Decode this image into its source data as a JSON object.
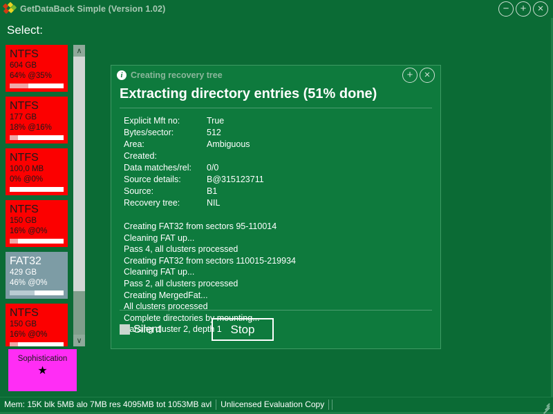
{
  "window": {
    "title": "GetDataBack Simple (Version 1.02)",
    "icon": "app-diamonds-icon",
    "controls": [
      {
        "name": "minimize",
        "glyph": "−"
      },
      {
        "name": "maximize",
        "glyph": "+"
      },
      {
        "name": "close",
        "glyph": "×"
      }
    ]
  },
  "select_label": "Select:",
  "drives": [
    {
      "fs": "NTFS",
      "size": "604 GB",
      "pct": "64% @35%",
      "bar_pct": 35,
      "type": "ntfs"
    },
    {
      "fs": "NTFS",
      "size": "177 GB",
      "pct": "18% @16%",
      "bar_pct": 16,
      "type": "ntfs"
    },
    {
      "fs": "NTFS",
      "size": "100,0 MB",
      "pct": "0% @0%",
      "bar_pct": 0,
      "type": "ntfs"
    },
    {
      "fs": "NTFS",
      "size": "150 GB",
      "pct": "16% @0%",
      "bar_pct": 16,
      "type": "ntfs"
    },
    {
      "fs": "FAT32",
      "size": "429 GB",
      "pct": "46% @0%",
      "bar_pct": 46,
      "type": "fat32"
    },
    {
      "fs": "NTFS",
      "size": "150 GB",
      "pct": "16% @0%",
      "bar_pct": 16,
      "type": "ntfs"
    }
  ],
  "scrollbar": {
    "up_glyph": "∧",
    "down_glyph": "∨"
  },
  "sophistication": {
    "label": "Sophistication",
    "star": "★"
  },
  "dialog": {
    "title": "Creating recovery tree",
    "info_icon_glyph": "i",
    "heading": "Extracting directory entries (51% done)",
    "progress_percent": 51,
    "controls": [
      {
        "name": "maximize",
        "glyph": "+"
      },
      {
        "name": "close",
        "glyph": "×"
      }
    ],
    "details": [
      {
        "key": "Explicit Mft no:",
        "value": "True"
      },
      {
        "key": "Bytes/sector:",
        "value": "512"
      },
      {
        "key": "Area:",
        "value": "Ambiguous"
      },
      {
        "key": "Created:",
        "value": ""
      },
      {
        "key": "Data matches/rel:",
        "value": "0/0"
      },
      {
        "key": "Source details:",
        "value": "B@315123711"
      },
      {
        "key": "Source:",
        "value": "B1"
      },
      {
        "key": "Recovery tree:",
        "value": "NIL"
      }
    ],
    "log": [
      "Creating FAT32 from sectors 95-110014",
      "Cleaning FAT up...",
      "Pass 4, all clusters processed",
      "Creating FAT32 from sectors 110015-219934",
      "Cleaning FAT up...",
      "Pass 2, all clusters processed",
      "Creating MergedFat...",
      "All clusters processed",
      "Complete directories by mounting...",
      "Parsing cluster 2, depth 1"
    ],
    "silent_label": "Silent",
    "silent_checked": false,
    "stop_label": "Stop"
  },
  "status_bar": {
    "memory": "Mem: 15K blk 5MB alo 7MB res 4095MB tot 1053MB avl",
    "license": "Unlicensed Evaluation Copy"
  },
  "colors": {
    "background": "#0b6b35",
    "dialog": "#0e7a3d",
    "ntfs_tile": "#fc0000",
    "fat32_tile": "#7d9ca5",
    "sophistication_tile": "#ff2df5"
  }
}
